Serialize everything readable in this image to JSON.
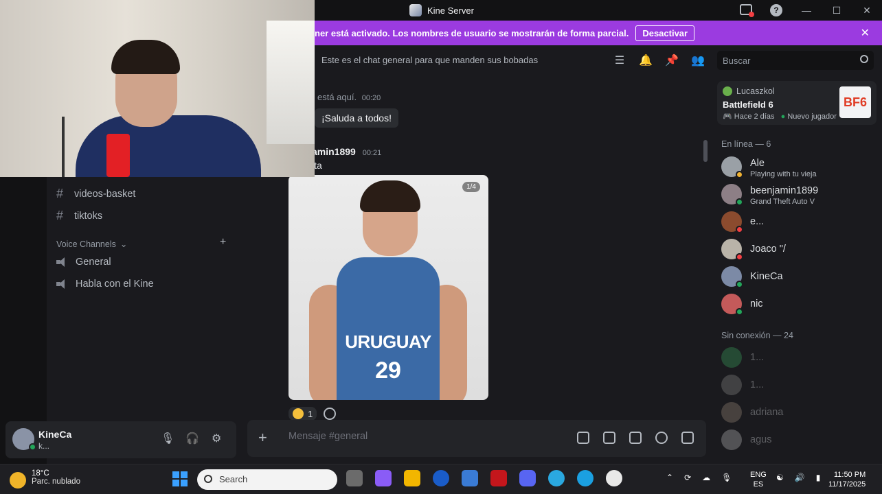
{
  "window": {
    "title": "Kine Server"
  },
  "notice": {
    "text": "ner está activado. Los nombres de usuario se mostrarán de forma parcial.",
    "button": "Desactivar"
  },
  "channels": {
    "text_items": [
      "videos-basket",
      "tiktoks"
    ],
    "voice_header": "Voice Channels",
    "voice_items": [
      "General",
      "Habla con el Kine"
    ]
  },
  "user_panel": {
    "name": "KineCa",
    "status": "k..."
  },
  "chat": {
    "topic": "Este es el chat general para que manden sus bobadas",
    "system_text": "está aquí.",
    "system_time": "00:20",
    "wave_text": "¡Saluda a todos!",
    "author": "amin1899",
    "author_time": "00:21",
    "message_fragment": "ita",
    "image_counter": "1/4",
    "jersey_text": "URUGUAY",
    "jersey_number": "29",
    "reaction_count": "1",
    "composer_placeholder": "Mensaje #general"
  },
  "right": {
    "search_placeholder": "Buscar",
    "activity": {
      "user": "Lucaszkol",
      "game": "Battlefield 6",
      "meta": "Hace 2 días",
      "meta2": "Nuevo jugador",
      "badge": "BF6"
    },
    "online_header": "En línea — 6",
    "online": [
      {
        "name": "Ale",
        "activity": "Playing with tu vieja",
        "color": "#9aa0a6",
        "status": "#f0b232"
      },
      {
        "name": "beenjamin1899",
        "activity": "Grand Theft Auto V",
        "color": "#8d7f86",
        "status": "#23a55a"
      },
      {
        "name": "e...",
        "activity": "",
        "color": "#8b4b2e",
        "status": "#f23f43"
      },
      {
        "name": "Joaco \"/",
        "activity": "",
        "color": "#b9b3a8",
        "status": "#f23f43"
      },
      {
        "name": "KineCa",
        "activity": "",
        "color": "#7c8aa6",
        "status": "#23a55a"
      },
      {
        "name": "nic",
        "activity": "",
        "color": "#c45a5a",
        "status": "#23a55a"
      }
    ],
    "offline_header": "Sin conexión — 24",
    "offline": [
      {
        "name": "1...",
        "color": "#3ba55d"
      },
      {
        "name": "1...",
        "color": "#8a8a8a"
      },
      {
        "name": "adriana",
        "color": "#9a8a7a"
      },
      {
        "name": "agus",
        "color": "#bbbbbb"
      }
    ]
  },
  "taskbar": {
    "temp": "18°C",
    "condition": "Parc. nublado",
    "search": "Search",
    "lang1": "ENG",
    "lang2": "ES",
    "time": "11:50 PM",
    "date": "11/17/2025"
  }
}
